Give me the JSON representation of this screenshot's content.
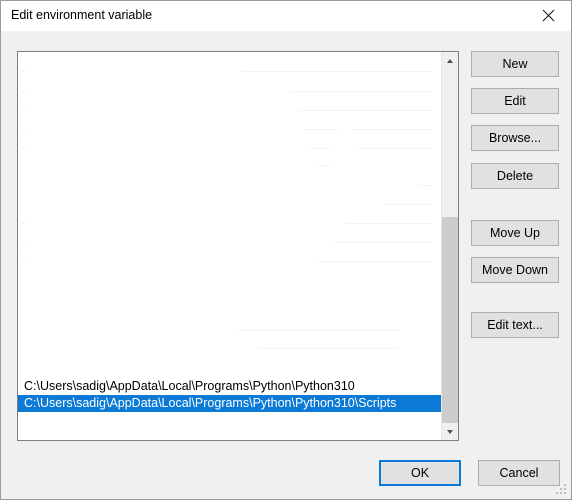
{
  "window": {
    "title": "Edit environment variable",
    "close_icon": "close-icon"
  },
  "list": {
    "items": [
      {
        "text": "C:\\Users\\sadig\\AppData\\Local\\Programs\\Python\\Python310",
        "selected": false
      },
      {
        "text": "C:\\Users\\sadig\\AppData\\Local\\Programs\\Python\\Python310\\Scripts",
        "selected": true
      }
    ],
    "selection_color": "#0b7ad6",
    "background": "#ffffff"
  },
  "scrollbar": {
    "up_icon": "chevron-up-icon",
    "down_icon": "chevron-down-icon",
    "thumb_color": "#cdcdcd"
  },
  "side_buttons": [
    {
      "id": "new",
      "label": "New"
    },
    {
      "id": "edit",
      "label": "Edit"
    },
    {
      "id": "browse",
      "label": "Browse..."
    },
    {
      "id": "delete",
      "label": "Delete"
    },
    {
      "id": "move_up",
      "label": "Move Up"
    },
    {
      "id": "move_down",
      "label": "Move Down"
    },
    {
      "id": "edit_text",
      "label": "Edit text..."
    }
  ],
  "footer": {
    "ok_label": "OK",
    "cancel_label": "Cancel",
    "default_button_color": "#0b7ad6",
    "resize_grip_icon": "resize-grip-icon"
  }
}
